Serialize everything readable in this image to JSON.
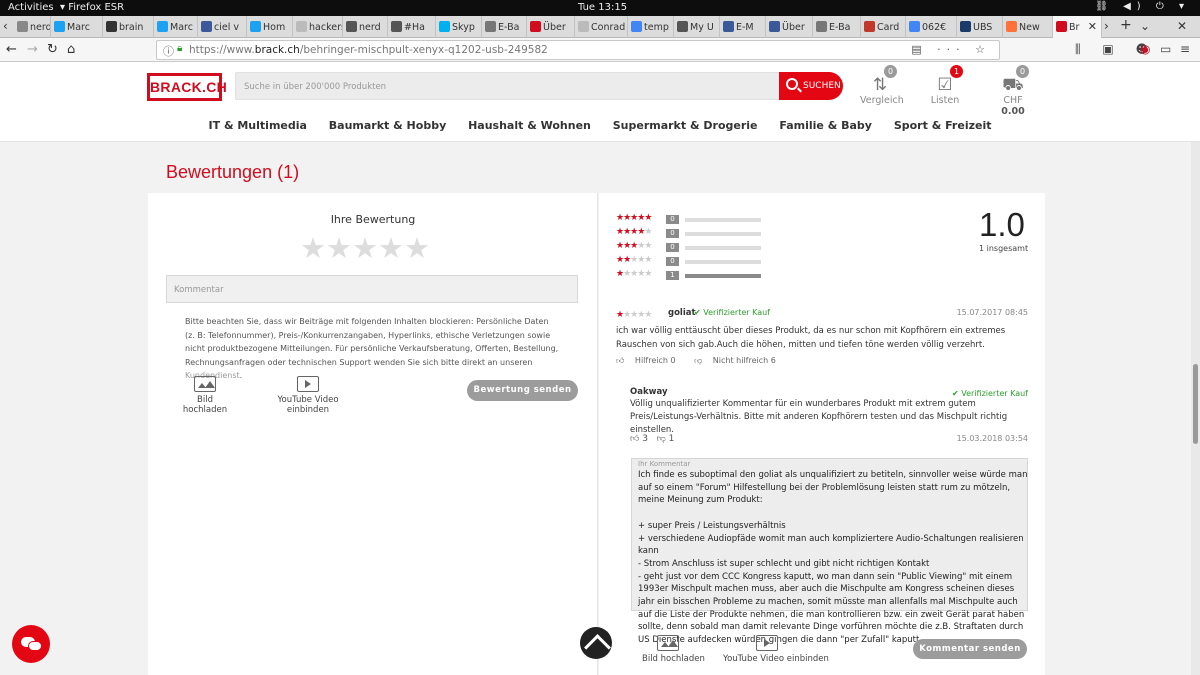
{
  "gnome": {
    "activities": "Activities",
    "app": "Firefox ESR",
    "clock": "Tue 13:15",
    "sys_icons": "⛓ ◀) ⏻ ▾"
  },
  "browser": {
    "tabs": [
      {
        "label": "nerd",
        "color": "#888"
      },
      {
        "label": "Marc",
        "color": "#1da1f2"
      },
      {
        "label": "brain",
        "color": "#333"
      },
      {
        "label": "Marc",
        "color": "#1da1f2"
      },
      {
        "label": "ciel v",
        "color": "#3b5998"
      },
      {
        "label": "Hom",
        "color": "#1da1f2"
      },
      {
        "label": "hackers",
        "color": "#bbb"
      },
      {
        "label": "nerd",
        "color": "#555"
      },
      {
        "label": "#Ha",
        "color": "#555"
      },
      {
        "label": "Skyp",
        "color": "#00aff0"
      },
      {
        "label": "E-Ba",
        "color": "#777"
      },
      {
        "label": "Über",
        "color": "#d10c1e"
      },
      {
        "label": "Conrad",
        "color": "#bbb"
      },
      {
        "label": "temp",
        "color": "#4285f4"
      },
      {
        "label": "My U",
        "color": "#555"
      },
      {
        "label": "E-M",
        "color": "#3b5998"
      },
      {
        "label": "Über",
        "color": "#3b5998"
      },
      {
        "label": "E-Ba",
        "color": "#777"
      },
      {
        "label": "Card",
        "color": "#c0392b"
      },
      {
        "label": "062€",
        "color": "#4285f4"
      },
      {
        "label": "UBS",
        "color": "#1a3a6b"
      },
      {
        "label": "New",
        "color": "#ff7139"
      },
      {
        "label": "Br",
        "color": "#d10c1e"
      }
    ],
    "url_prefix": "https://www.",
    "url_domain": "brack.ch",
    "url_path": "/behringer-mischpult-xenyx-q1202-usb-249582",
    "url_right_icons": "▤ ··· ☆",
    "nav_right_icons": "⫼ ▣ ☻"
  },
  "header": {
    "logo": "BRACK.CH",
    "search_placeholder": "Suche in über 200'000 Produkten",
    "search_button": "SUCHEN",
    "compare_label": "Vergleich",
    "compare_count": "0",
    "lists_label": "Listen",
    "lists_count": "1",
    "cart_label_prefix": "CHF ",
    "cart_amount": "0.00",
    "cart_count": "0",
    "categories": [
      "IT & Multimedia",
      "Baumarkt & Hobby",
      "Haushalt & Wohnen",
      "Supermarkt & Drogerie",
      "Familie & Baby",
      "Sport & Freizeit"
    ]
  },
  "reviews": {
    "title": "Bewertungen (1)",
    "your_rating_label": "Ihre Bewertung",
    "comment_placeholder": "Kommentar",
    "notice": "Bitte beachten Sie, dass wir Beiträge mit folgenden Inhalten blockieren: Persönliche Daten (z. B: Telefonnummer), Preis-/Konkurrenzangaben, Hyperlinks, ethische Verletzungen sowie nicht produktbezogene Mitteilungen. Für persönliche Verkaufsberatung, Offerten, Bestellung, Rechnungsanfragen oder technischen Support wenden Sie sich bitte direkt an unseren ",
    "notice_link": "Kundendienst",
    "notice_end": ".",
    "upload_image": "Bild hochladen",
    "embed_video": "YouTube Video einbinden",
    "submit_review": "Bewertung senden",
    "histogram": [
      {
        "stars": 5,
        "count": "0",
        "fraction": 0
      },
      {
        "stars": 4,
        "count": "0",
        "fraction": 0
      },
      {
        "stars": 3,
        "count": "0",
        "fraction": 0
      },
      {
        "stars": 2,
        "count": "0",
        "fraction": 0
      },
      {
        "stars": 1,
        "count": "1",
        "fraction": 1
      }
    ],
    "average": "1.0",
    "total": "1 insgesamt",
    "review": {
      "stars": 1,
      "author": "goliat",
      "verified": "✔ Verifizierter Kauf",
      "date": "15.07.2017 08:45",
      "text": "ich war völlig enttäuscht über dieses Produkt, da es nur schon mit Kopfhörern ein extremes Rauschen von sich gab.Auch die höhen, mitten und tiefen töne werden völlig verzehrt.",
      "helpful": "Hilfreich 0",
      "not_helpful": "Nicht hilfreich 6"
    },
    "reply": {
      "author": "Oakway",
      "verified": "✔ Verifizierter Kauf",
      "text": "Völlig unqualifizierter Kommentar für ein wunderbares Produkt mit extrem gutem Preis/Leistungs-Verhältnis. Bitte mit anderen Kopfhörern testen und das Mischpult richtig einstellen.",
      "likes": "3",
      "dislikes": "1",
      "date": "15.03.2018 03:54"
    },
    "my_comment_label": "Ihr Kommentar",
    "my_comment": "Ich finde es suboptimal den goliat als unqualifiziert zu betiteln, sinnvoller weise würde man auf so einem \"Forum\" Hilfestellung bei der Problemlösung leisten statt rum zu mötzeln, meine Meinung zum Produkt:\n\n+ super Preis / Leistungsverhältnis\n+ verschiedene Audiopfäde womit man auch kompliziertere Audio-Schaltungen realisieren kann\n- Strom Anschluss ist super schlecht und gibt nicht richtigen Kontakt\n- geht just vor dem CCC Kongress kaputt, wo man dann sein \"Public Viewing\" mit einem 1993er Mischpult machen muss, aber auch die Mischpulte am Kongress scheinen dieses jahr ein bisschen Probleme zu machen, somit müsste man allenfalls mal Mischpulte auch auf die Liste der Produkte nehmen, die man kontrollieren bzw. ein zweit Gerät parat haben sollte, denn sobald man damit relevante Dinge vorführen möchte die z.B. Straftaten durch US Dienste aufdecken würden gingen die dann \"per Zufall\" kaputt",
    "submit_comment": "Kommentar senden"
  },
  "colors": {
    "accent": "#e30613",
    "brand": "#d10c1e",
    "verified": "#2e9b2e"
  }
}
